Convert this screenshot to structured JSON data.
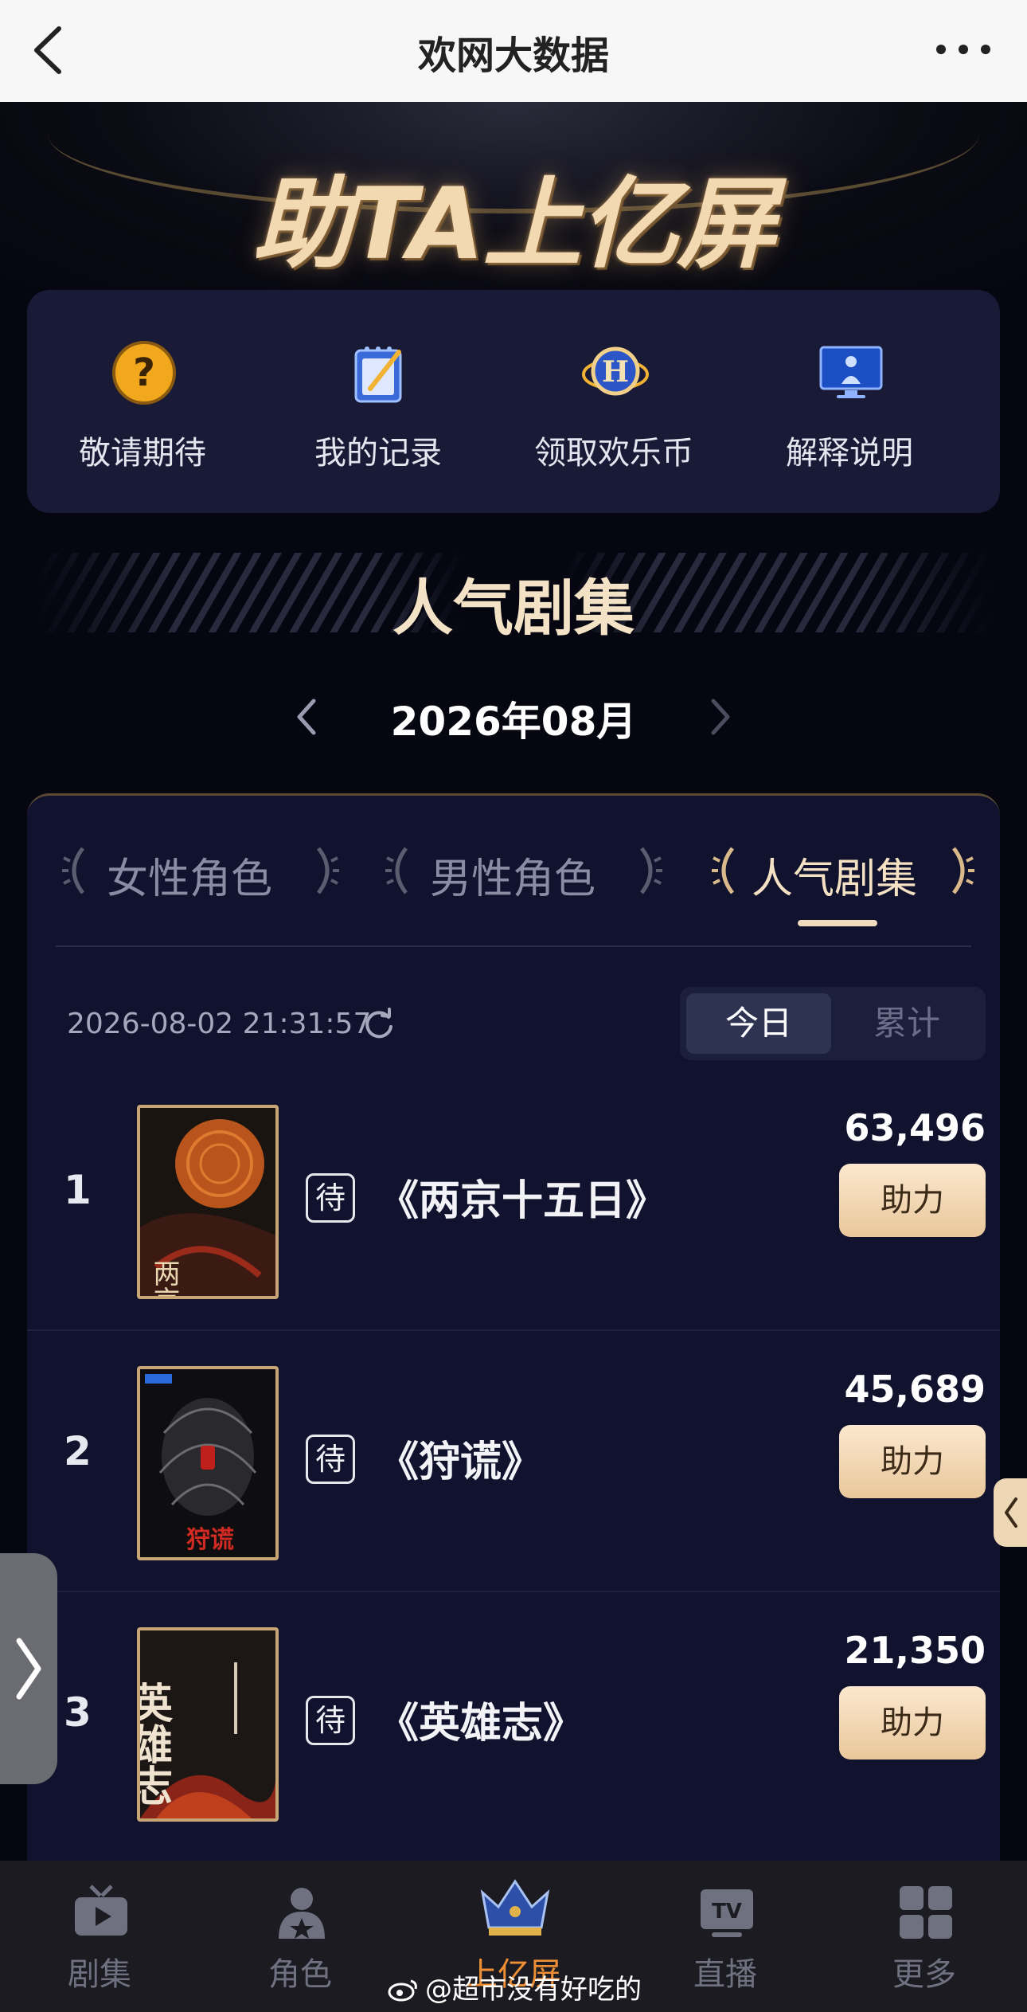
{
  "topbar": {
    "title": "欢网大数据"
  },
  "hero": {
    "headline": "助TA上亿屏"
  },
  "quick_menu": [
    {
      "label": "敬请期待",
      "icon": "question-icon"
    },
    {
      "label": "我的记录",
      "icon": "notebook-icon"
    },
    {
      "label": "领取欢乐币",
      "icon": "coin-icon"
    },
    {
      "label": "解释说明",
      "icon": "monitor-icon"
    }
  ],
  "section": {
    "title": "人气剧集"
  },
  "month": {
    "label": "2026年08月"
  },
  "tabs": [
    {
      "label": "女性角色",
      "active": false
    },
    {
      "label": "男性角色",
      "active": false
    },
    {
      "label": "人气剧集",
      "active": true
    }
  ],
  "timestamp": "2026-08-02 21:31:57",
  "toggle": {
    "today": "今日",
    "total": "累计"
  },
  "rows": [
    {
      "rank": "1",
      "badge": "待",
      "name": "《两京十五日》",
      "score": "63,496",
      "button": "助力",
      "poster_text": "两京十五日"
    },
    {
      "rank": "2",
      "badge": "待",
      "name": "《狩谎》",
      "score": "45,689",
      "button": "助力",
      "poster_text": "狩谎"
    },
    {
      "rank": "3",
      "badge": "待",
      "name": "《英雄志》",
      "score": "21,350",
      "button": "助力",
      "poster_text": "英雄志"
    }
  ],
  "tabbar": [
    {
      "label": "剧集",
      "icon": "tv-play-icon",
      "active": false
    },
    {
      "label": "角色",
      "icon": "person-star-icon",
      "active": false
    },
    {
      "label": "上亿屏",
      "icon": "crown-icon",
      "active": true
    },
    {
      "label": "直播",
      "icon": "tv-live-icon",
      "active": false
    },
    {
      "label": "更多",
      "icon": "grid-icon",
      "active": false
    }
  ],
  "tabbar_live_icon_text": "TV",
  "watermark": "@超市没有好吃的",
  "colors": {
    "accent_gold": "#f1dcc0",
    "active_tab_orange": "#ef8f35",
    "background": "#05060f",
    "card": "#11132e"
  }
}
